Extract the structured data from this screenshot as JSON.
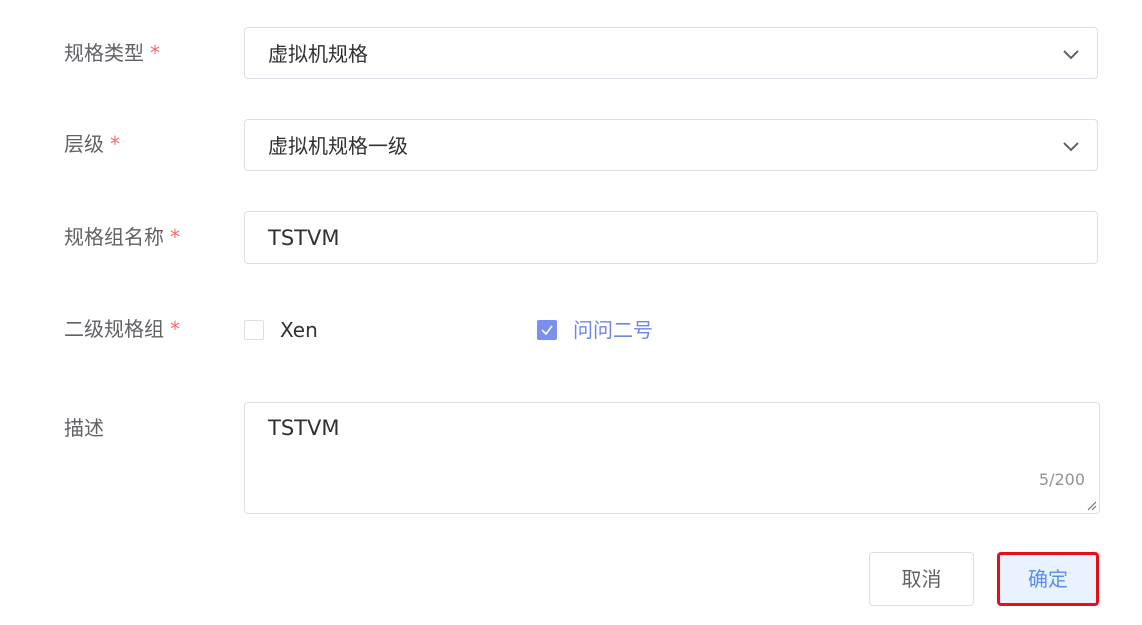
{
  "form": {
    "spec_type": {
      "label": "规格类型",
      "required_mark": "*",
      "value": "虚拟机规格",
      "icon": "chevron-down-icon"
    },
    "level": {
      "label": "层级",
      "required_mark": "*",
      "value": "虚拟机规格一级",
      "icon": "chevron-down-icon"
    },
    "group_name": {
      "label": "规格组名称",
      "required_mark": "*",
      "value": "TSTVM"
    },
    "secondary_groups": {
      "label": "二级规格组",
      "required_mark": "*",
      "options": [
        {
          "label": "Xen",
          "checked": false
        },
        {
          "label": "问问二号",
          "checked": true
        }
      ]
    },
    "description": {
      "label": "描述",
      "value": "TSTVM",
      "count": "5/200"
    }
  },
  "actions": {
    "cancel_label": "取消",
    "confirm_label": "确定"
  },
  "colors": {
    "required": "#f56c6c",
    "checkbox_checked": "#7b8ff0",
    "confirm_highlight_border": "#e3101a",
    "confirm_bg": "#e9f2ff",
    "confirm_text": "#5b8def"
  }
}
